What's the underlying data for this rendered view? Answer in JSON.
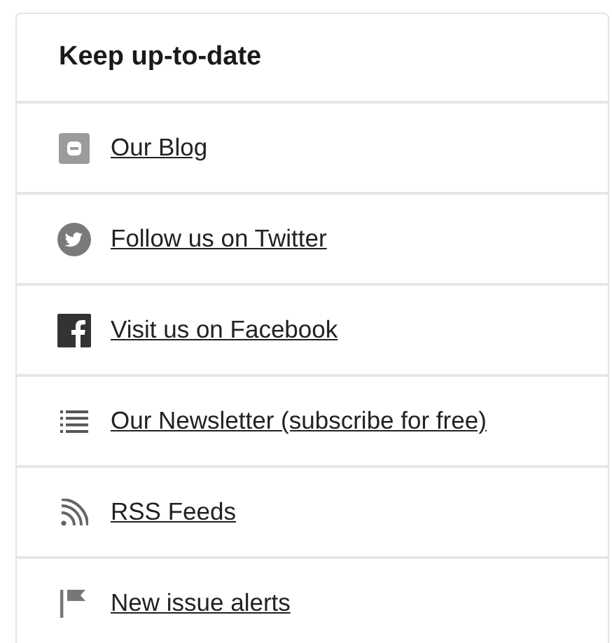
{
  "panel": {
    "title": "Keep up-to-date"
  },
  "links": [
    {
      "kind": "blog",
      "label": "Our Blog"
    },
    {
      "kind": "twitter",
      "label": "Follow us on Twitter"
    },
    {
      "kind": "facebook",
      "label": "Visit us on Facebook"
    },
    {
      "kind": "list",
      "label": "Our Newsletter (subscribe for free)"
    },
    {
      "kind": "rss",
      "label": "RSS Feeds"
    },
    {
      "kind": "flag",
      "label": "New issue alerts"
    }
  ]
}
